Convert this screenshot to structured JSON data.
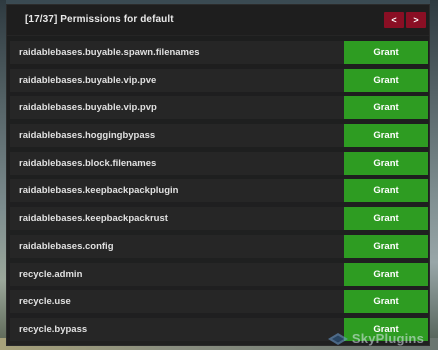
{
  "panel": {
    "title": "[17/37] Permissions for default",
    "prev_label": "<",
    "next_label": ">"
  },
  "rows": [
    {
      "permission": "raidablebases.buyable.spawn.filenames",
      "action": "Grant"
    },
    {
      "permission": "raidablebases.buyable.vip.pve",
      "action": "Grant"
    },
    {
      "permission": "raidablebases.buyable.vip.pvp",
      "action": "Grant"
    },
    {
      "permission": "raidablebases.hoggingbypass",
      "action": "Grant"
    },
    {
      "permission": "raidablebases.block.filenames",
      "action": "Grant"
    },
    {
      "permission": "raidablebases.keepbackpackplugin",
      "action": "Grant"
    },
    {
      "permission": "raidablebases.keepbackpackrust",
      "action": "Grant"
    },
    {
      "permission": "raidablebases.config",
      "action": "Grant"
    },
    {
      "permission": "recycle.admin",
      "action": "Grant"
    },
    {
      "permission": "recycle.use",
      "action": "Grant"
    },
    {
      "permission": "recycle.bypass",
      "action": "Grant"
    }
  ],
  "watermark": {
    "text": "SkyPlugins",
    "icon": "skyplugins-logo-icon"
  },
  "colors": {
    "grant_green": "#2e9c22",
    "nav_red": "#8a0f24",
    "panel_bg": "#1c1c1c",
    "row_bg": "#262626"
  }
}
